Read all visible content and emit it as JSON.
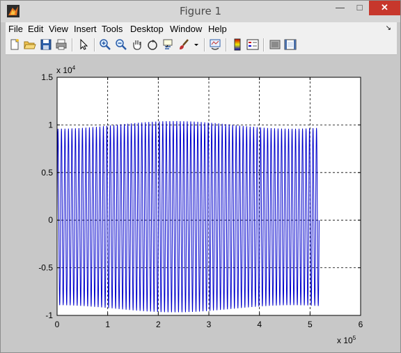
{
  "window": {
    "title": "Figure 1",
    "minimize": "—",
    "maximize": "□",
    "close": "✕"
  },
  "menu": [
    "File",
    "Edit",
    "View",
    "Insert",
    "Tools",
    "Desktop",
    "Window",
    "Help"
  ],
  "menu_dock_icon": "dock-arrow-icon",
  "toolbar": [
    "new-figure-icon",
    "open-file-icon",
    "save-icon",
    "print-icon",
    "edit-plot-arrow-icon",
    "zoom-in-icon",
    "zoom-out-icon",
    "pan-hand-icon",
    "rotate-3d-icon",
    "data-cursor-icon",
    "brush-icon",
    "link-plot-icon",
    "insert-colorbar-icon",
    "insert-legend-icon",
    "hide-plot-tools-icon",
    "show-plot-tools-icon"
  ],
  "chart_data": {
    "type": "line",
    "title": "",
    "xlabel": "",
    "ylabel": "",
    "x_exponent_label": "x 10",
    "x_exponent": "5",
    "y_exponent_label": "x 10",
    "y_exponent": "4",
    "xlim": [
      0,
      6
    ],
    "ylim": [
      -1,
      1.5
    ],
    "x_ticks": [
      "0",
      "1",
      "2",
      "3",
      "4",
      "5",
      "6"
    ],
    "y_ticks": [
      "-1",
      "-0.5",
      "0",
      "0.5",
      "1",
      "1.5"
    ],
    "grid": true,
    "series": [
      {
        "color": "#0000cc",
        "x_range": [
          0,
          5.18
        ],
        "cycles": 75,
        "max": 1.0,
        "min": -0.93,
        "offset": 0.05
      }
    ]
  }
}
